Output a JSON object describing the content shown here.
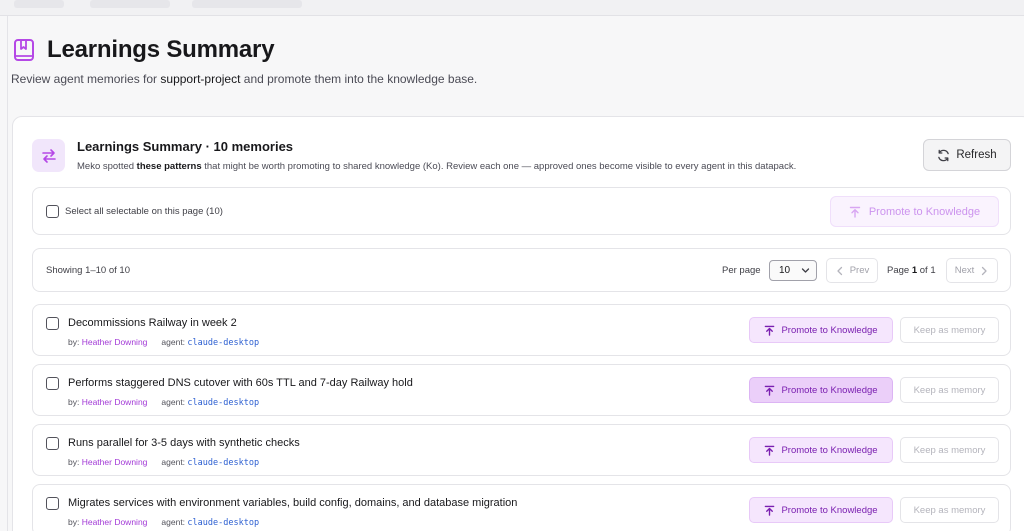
{
  "header": {
    "title": "Learnings Summary",
    "subtitle_prefix": "Review agent memories for ",
    "project": "support-project",
    "subtitle_suffix": " and promote them into the knowledge base."
  },
  "card": {
    "title": "Learnings Summary · 10 memories",
    "desc_prefix": "Meko spotted ",
    "desc_bold": "these patterns",
    "desc_suffix": " that might be worth promoting to shared knowledge (Ko). Review each one — approved ones become visible to every agent in this datapack.",
    "refresh_label": "Refresh"
  },
  "selection": {
    "select_all_label": "Select all selectable on this page (10)",
    "promote_label": "Promote to Knowledge"
  },
  "pagination": {
    "showing": "Showing 1–10 of 10",
    "per_page_label": "Per page",
    "per_page_value": "10",
    "prev_label": "Prev",
    "page_prefix": "Page ",
    "page_current": "1",
    "page_suffix": " of 1",
    "next_label": "Next"
  },
  "memories": [
    {
      "title": "Decommissions Railway in week 2",
      "by_label": "by:",
      "author": "Heather Downing",
      "agent_label": "agent:",
      "agent": "claude-desktop",
      "promote_label": "Promote to Knowledge",
      "keep_label": "Keep as memory"
    },
    {
      "title": "Performs staggered DNS cutover with 60s TTL and 7-day Railway hold",
      "by_label": "by:",
      "author": "Heather Downing",
      "agent_label": "agent:",
      "agent": "claude-desktop",
      "promote_label": "Promote to Knowledge",
      "keep_label": "Keep as memory"
    },
    {
      "title": "Runs parallel for 3-5 days with synthetic checks",
      "by_label": "by:",
      "author": "Heather Downing",
      "agent_label": "agent:",
      "agent": "claude-desktop",
      "promote_label": "Promote to Knowledge",
      "keep_label": "Keep as memory"
    },
    {
      "title": "Migrates services with environment variables, build config, domains, and database migration",
      "by_label": "by:",
      "author": "Heather Downing",
      "agent_label": "agent:",
      "agent": "claude-desktop",
      "promote_label": "Promote to Knowledge",
      "keep_label": "Keep as memory"
    }
  ],
  "colors": {
    "accent": "#a23ad6",
    "promote_text": "#7a1fb0",
    "promote_bg": "#f5e6fd",
    "agent_text": "#2c5fd1"
  },
  "icons": {
    "page": "book-bookmark-icon",
    "card": "swap-arrows-icon",
    "refresh": "refresh-icon",
    "promote": "upload-arrow-icon",
    "prev": "chevron-left-icon",
    "next": "chevron-right-icon"
  }
}
